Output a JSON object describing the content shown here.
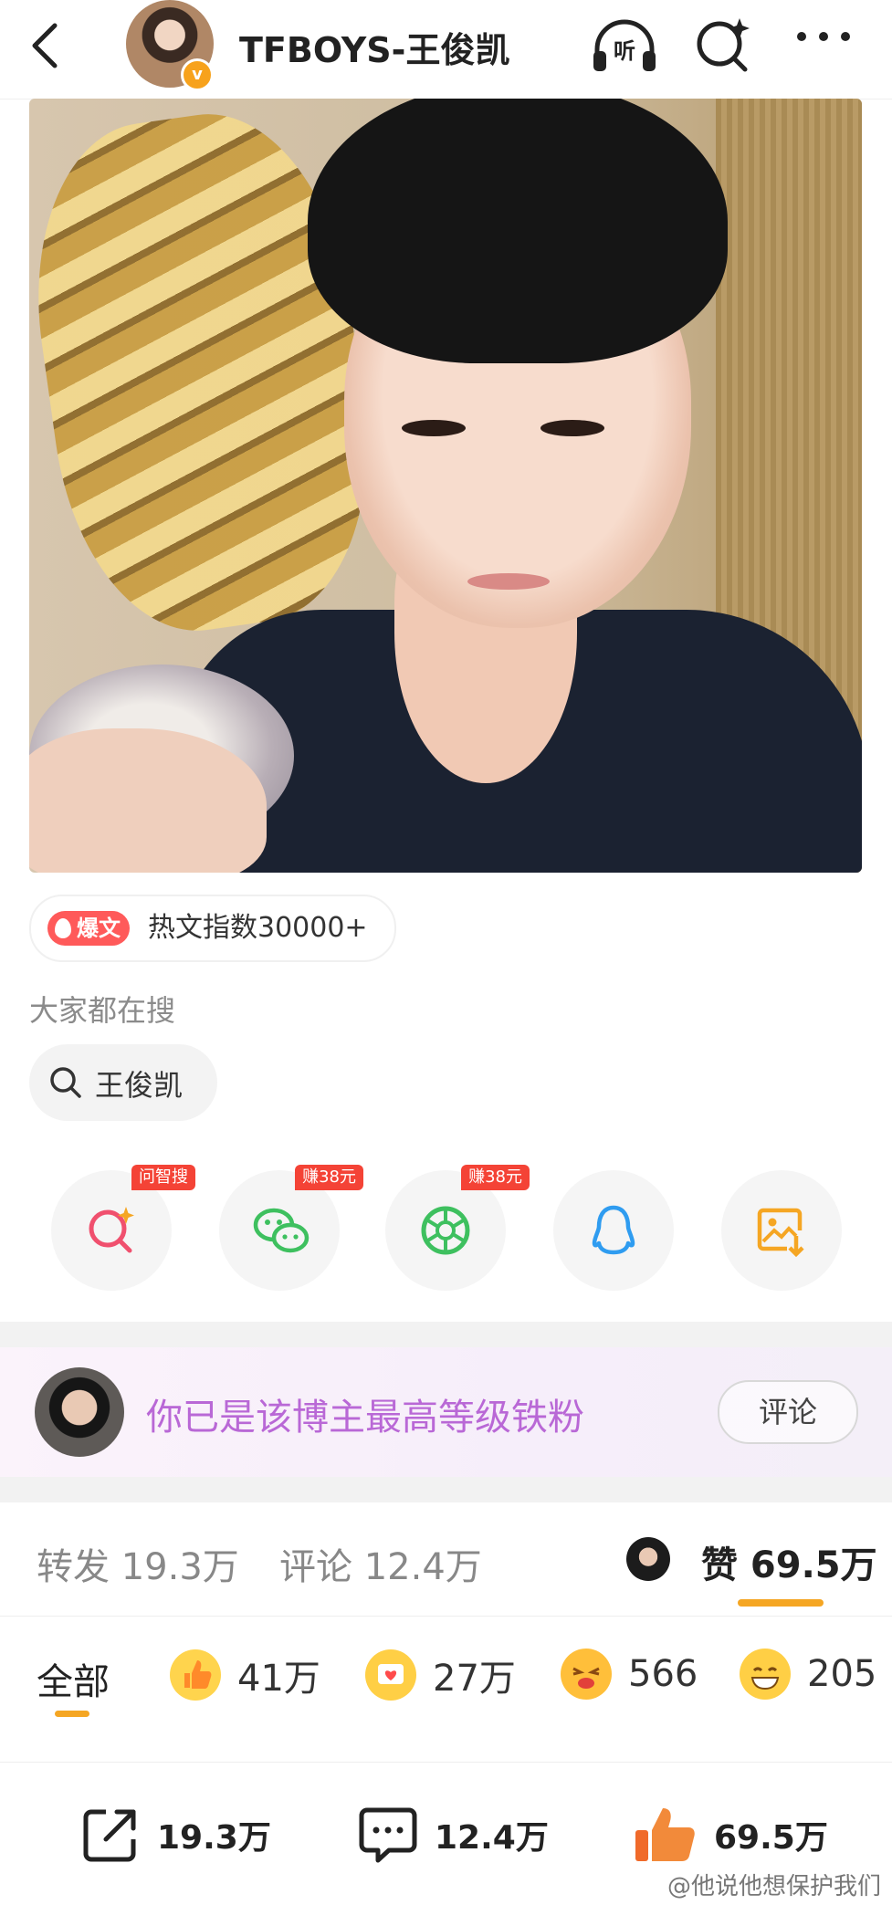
{
  "header": {
    "title": "TFBOYS-王俊凯",
    "listen_label": "听"
  },
  "hot_badge": {
    "tag": "爆文",
    "text": "热文指数30000+"
  },
  "search": {
    "caption": "大家都在搜",
    "chip": "王俊凯"
  },
  "share": [
    {
      "name": "ai-search",
      "tag": "问智搜",
      "color": "#f0506e"
    },
    {
      "name": "wechat",
      "tag": "赚38元",
      "color": "#3ec05f"
    },
    {
      "name": "moments",
      "tag": "赚38元",
      "color": "#3ec05f"
    },
    {
      "name": "qq",
      "tag": "",
      "color": "#2f9cf0"
    },
    {
      "name": "save-image",
      "tag": "",
      "color": "#f5a623"
    }
  ],
  "fan_banner": {
    "text": "你已是该博主最高等级铁粉",
    "button": "评论"
  },
  "stats": {
    "repost": "转发 19.3万",
    "comment": "评论 12.4万",
    "like": "赞 69.5万"
  },
  "reactions": {
    "all": "全部",
    "items": [
      {
        "icon": "thumbs-up-icon",
        "count": "41万"
      },
      {
        "icon": "heart-message-icon",
        "count": "27万"
      },
      {
        "icon": "wink-face-icon",
        "count": "566"
      },
      {
        "icon": "grin-face-icon",
        "count": "205"
      }
    ]
  },
  "bottom_bar": {
    "share_count": "19.3万",
    "comment_count": "12.4万",
    "like_count": "69.5万"
  },
  "watermark": "@他说他想保护我们"
}
